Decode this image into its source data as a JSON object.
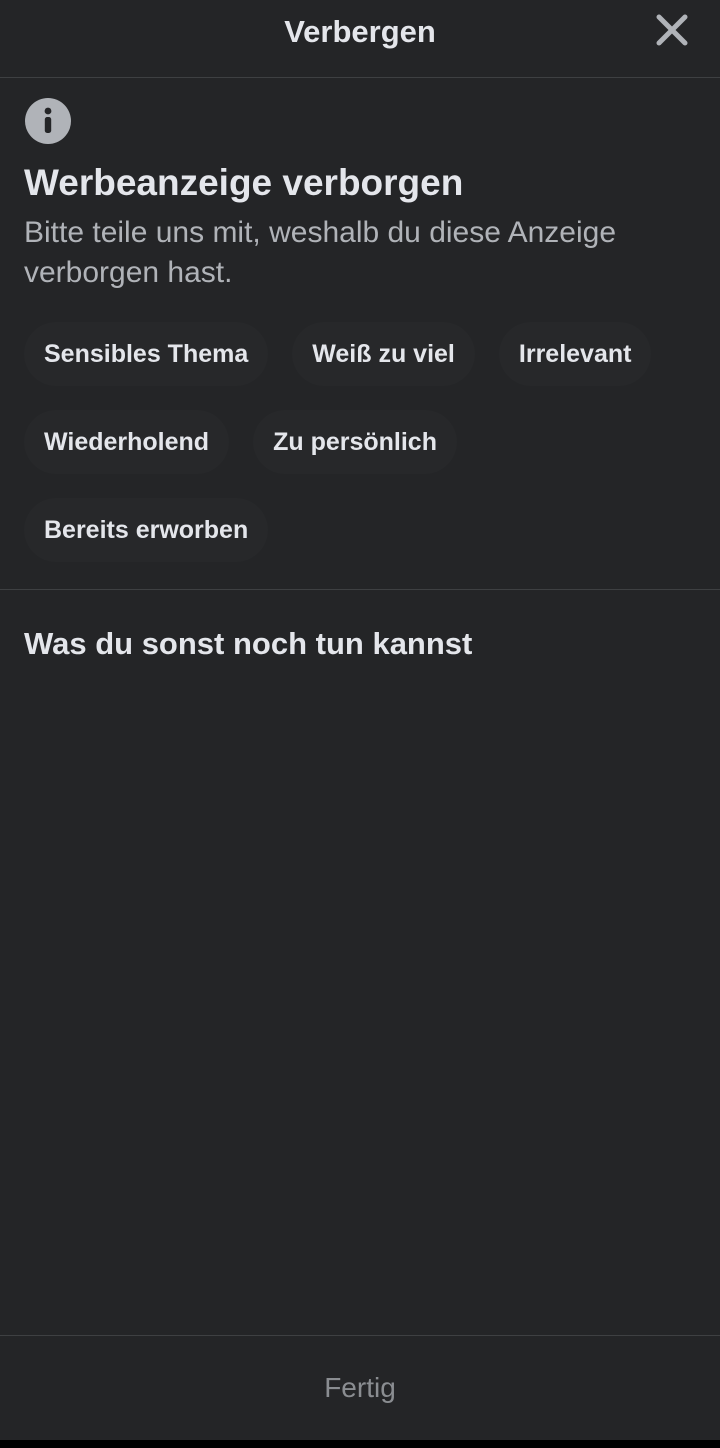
{
  "header": {
    "title": "Verbergen",
    "close_icon": "close-icon"
  },
  "notice": {
    "icon": "info-icon",
    "title": "Werbeanzeige verborgen",
    "subtitle": "Bitte teile uns mit, weshalb du diese Anzeige verborgen hast."
  },
  "reasons": [
    {
      "label": "Sensibles Thema"
    },
    {
      "label": "Weiß zu viel"
    },
    {
      "label": "Irrelevant"
    },
    {
      "label": "Wiederholend"
    },
    {
      "label": "Zu persönlich"
    },
    {
      "label": "Bereits erworben"
    }
  ],
  "more": {
    "title": "Was du sonst noch tun kannst"
  },
  "footer": {
    "done_label": "Fertig"
  },
  "colors": {
    "background": "#242527",
    "text_primary": "#e4e6eb",
    "text_secondary": "#b0b3b8",
    "divider": "#3e4042",
    "chip_background": "#27282a",
    "disabled_text": "#8a8d91"
  }
}
